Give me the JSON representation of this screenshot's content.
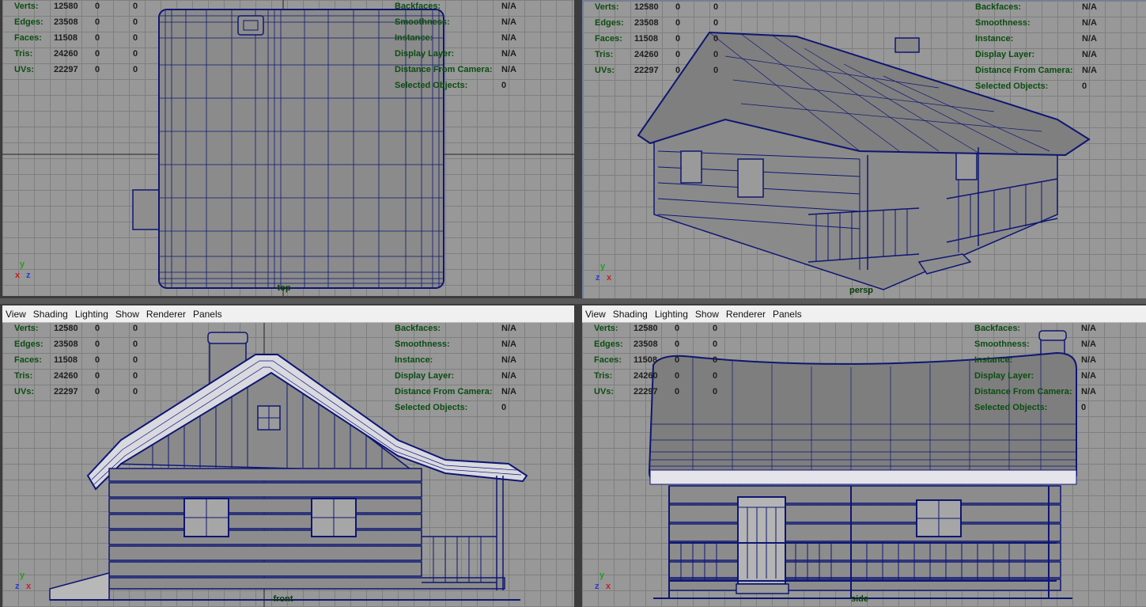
{
  "menu": [
    "View",
    "Shading",
    "Lighting",
    "Show",
    "Renderer",
    "Panels"
  ],
  "hud": {
    "left": [
      {
        "label": "Verts:",
        "v1": "12580",
        "v2": "0",
        "v3": "0"
      },
      {
        "label": "Edges:",
        "v1": "23508",
        "v2": "0",
        "v3": "0"
      },
      {
        "label": "Faces:",
        "v1": "11508",
        "v2": "0",
        "v3": "0"
      },
      {
        "label": "Tris:",
        "v1": "24260",
        "v2": "0",
        "v3": "0"
      },
      {
        "label": "UVs:",
        "v1": "22297",
        "v2": "0",
        "v3": "0"
      }
    ],
    "right": [
      {
        "label": "Backfaces:",
        "value": "N/A"
      },
      {
        "label": "Smoothness:",
        "value": "N/A"
      },
      {
        "label": "Instance:",
        "value": "N/A"
      },
      {
        "label": "Display Layer:",
        "value": "N/A"
      },
      {
        "label": "Distance From Camera:",
        "value": "N/A"
      },
      {
        "label": "Selected Objects:",
        "value": "0"
      }
    ]
  },
  "viewports": [
    {
      "id": "top",
      "camera": "top",
      "axes": [
        "y",
        "x",
        "z"
      ]
    },
    {
      "id": "persp",
      "camera": "persp",
      "axes": [
        "y",
        "z",
        "x"
      ]
    },
    {
      "id": "front",
      "camera": "front",
      "axes": [
        "y",
        "z",
        "x"
      ]
    },
    {
      "id": "side",
      "camera": "side",
      "axes": [
        "y",
        "z",
        "x"
      ]
    }
  ],
  "colors": {
    "grid_bg": "#989898",
    "wire": "#0e1673",
    "hud_label": "#0b4d11",
    "axis_x": "#c81e1e",
    "axis_y": "#1fa01f",
    "axis_z": "#2340d8"
  }
}
